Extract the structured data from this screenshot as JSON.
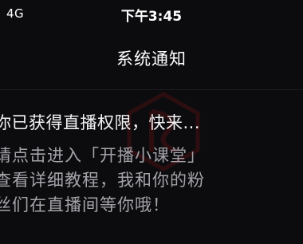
{
  "status_bar": {
    "network": "4G",
    "time": "下午3:45"
  },
  "header": {
    "title": "系统通知"
  },
  "message": {
    "headline": "你已获得直播权限，快来...",
    "body_lines": [
      "请点击进入「开播小课堂」",
      "查看详细教程，我和你的粉",
      "丝们在直播间等你哦！"
    ]
  },
  "watermark": {
    "icon": "app-logo-watermark-icon",
    "color": "#6a1414"
  }
}
